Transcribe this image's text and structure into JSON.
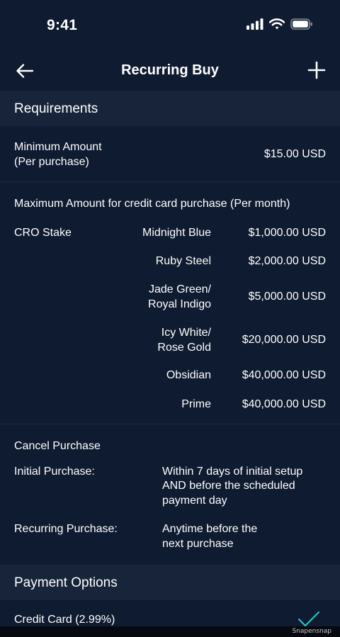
{
  "status_bar": {
    "time": "9:41"
  },
  "nav": {
    "title": "Recurring Buy"
  },
  "requirements": {
    "header": "Requirements",
    "min_amount_label_1": "Minimum Amount",
    "min_amount_label_2": "(Per purchase)",
    "min_amount_value": "$15.00 USD",
    "max_amount_label": "Maximum Amount for credit card purchase (Per month)",
    "stake_label": "CRO Stake",
    "tiers": [
      {
        "line1": "Midnight Blue",
        "line2": "",
        "amount": "$1,000.00 USD"
      },
      {
        "line1": "Ruby Steel",
        "line2": "",
        "amount": "$2,000.00 USD"
      },
      {
        "line1": "Jade Green/",
        "line2": "Royal Indigo",
        "amount": "$5,000.00 USD"
      },
      {
        "line1": "Icy White/",
        "line2": "Rose Gold",
        "amount": "$20,000.00 USD"
      },
      {
        "line1": "Obsidian",
        "line2": "",
        "amount": "$40,000.00 USD"
      },
      {
        "line1": "Prime",
        "line2": "",
        "amount": "$40,000.00 USD"
      }
    ]
  },
  "cancel": {
    "title": "Cancel Purchase",
    "initial_label": "Initial Purchase:",
    "initial_lines": [
      "Within 7 days of initial setup",
      "AND before the scheduled",
      "payment day"
    ],
    "recurring_label": "Recurring Purchase:",
    "recurring_lines": [
      "Anytime before the",
      "next purchase"
    ]
  },
  "payment": {
    "header": "Payment Options",
    "option_label": "Credit Card (2.99%)"
  },
  "icons": {
    "back": "arrow-left-icon",
    "add": "plus-icon",
    "check": "checkmark-icon",
    "signal": "cellular-signal-icon",
    "wifi": "wifi-icon",
    "battery": "battery-icon"
  },
  "colors": {
    "background": "#0f1b30",
    "section_header": "#17243a",
    "check": "#1fc7c2"
  },
  "watermark": "Snapensnap"
}
